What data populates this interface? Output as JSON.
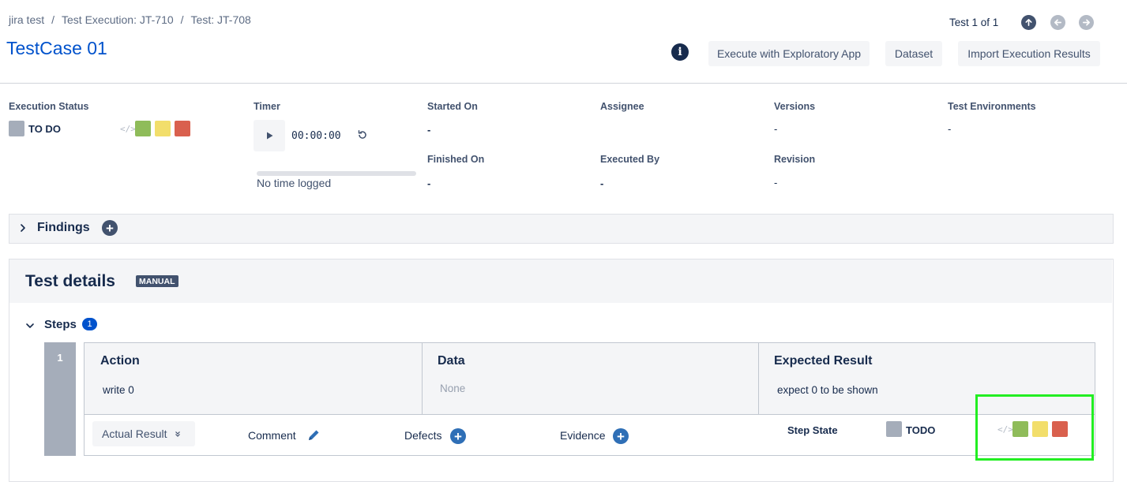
{
  "breadcrumb": {
    "project": "jira test",
    "sep": "/",
    "execution": "Test Execution: JT-710",
    "test": "Test: JT-708"
  },
  "page_title": "TestCase 01",
  "pager": {
    "label": "Test 1 of 1"
  },
  "toolbar": {
    "info": "i",
    "exploratory": "Execute with Exploratory App",
    "dataset": "Dataset",
    "import": "Import Execution Results"
  },
  "execution": {
    "status_label": "Execution Status",
    "status_value": "TO DO",
    "code_icon": "</>",
    "timer_label": "Timer",
    "timer_value": "00:00:00",
    "no_time": "No time logged",
    "started_label": "Started On",
    "started_value": "-",
    "finished_label": "Finished On",
    "finished_value": "-",
    "assignee_label": "Assignee",
    "executed_label": "Executed By",
    "executed_value": "-",
    "versions_label": "Versions",
    "versions_value": "-",
    "revision_label": "Revision",
    "revision_value": "-",
    "env_label": "Test Environments",
    "env_value": "-"
  },
  "findings": {
    "label": "Findings",
    "add": "+"
  },
  "details": {
    "title": "Test details",
    "badge": "MANUAL",
    "steps_label": "Steps",
    "steps_count": "1",
    "step": {
      "number": "1",
      "action_head": "Action",
      "action_value": "write 0",
      "data_head": "Data",
      "data_value": "None",
      "expected_head": "Expected Result",
      "expected_value": "expect 0 to be shown",
      "actual_result": "Actual Result",
      "comment": "Comment",
      "defects": "Defects",
      "evidence": "Evidence",
      "plus": "+",
      "state_label": "Step State",
      "state_value": "TODO"
    }
  },
  "colors": {
    "pass": "#8fbc5a",
    "executing": "#f2de6b",
    "fail": "#d9604e",
    "todo": "#a5adba",
    "link": "#0052cc",
    "highlight": "#22ee22"
  }
}
